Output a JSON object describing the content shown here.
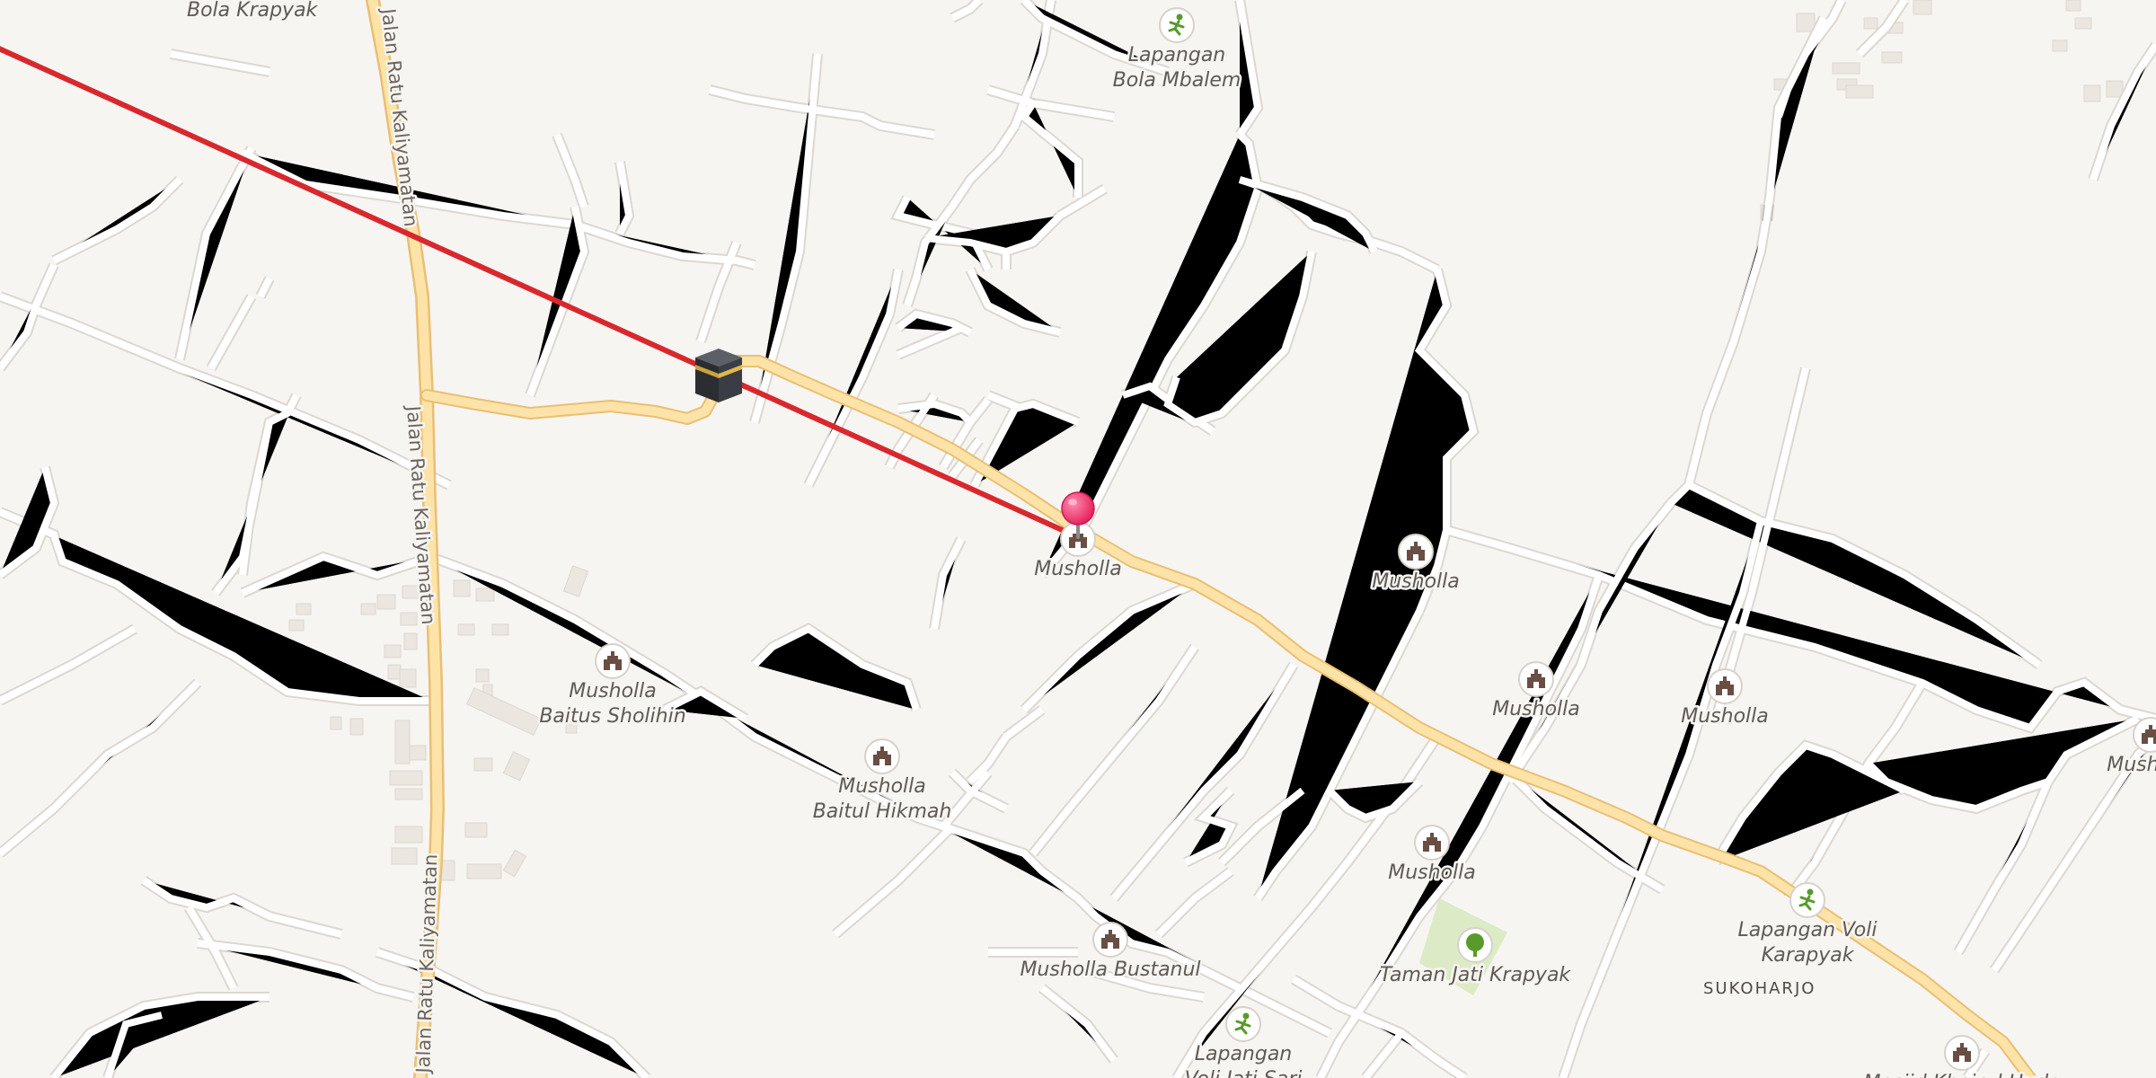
{
  "map": {
    "road_labels": [
      "Jalan Ratu Kaliyamatan",
      "Jalan Ratu Kaliyamatan",
      "Jalan Ratu Kaliyamatan"
    ],
    "area_labels": [
      "SUKOHARJO"
    ],
    "pois": [
      {
        "type": "musholla",
        "icon": "mosque-icon",
        "lines": [
          "Musholla"
        ]
      },
      {
        "type": "musholla",
        "icon": "mosque-icon",
        "lines": [
          "Musholla"
        ]
      },
      {
        "type": "musholla",
        "icon": "mosque-icon",
        "lines": [
          "Musholla"
        ]
      },
      {
        "type": "musholla",
        "icon": "mosque-icon",
        "lines": [
          "Musholla"
        ]
      },
      {
        "type": "musholla",
        "icon": "mosque-icon",
        "lines": [
          "Musholla"
        ]
      },
      {
        "type": "musholla",
        "icon": "mosque-icon",
        "lines": [
          "Musholla"
        ]
      },
      {
        "type": "musholla",
        "icon": "mosque-icon",
        "lines": [
          "Musholla",
          "Baitus Sholihin"
        ]
      },
      {
        "type": "musholla",
        "icon": "mosque-icon",
        "lines": [
          "Musholla",
          "Baitul Hikmah"
        ]
      },
      {
        "type": "musholla",
        "icon": "mosque-icon",
        "lines": [
          "Musholla Bustanul"
        ]
      },
      {
        "type": "musholla",
        "icon": "mosque-icon",
        "lines": [
          "Masjid Khoirul Huda"
        ]
      },
      {
        "type": "sports",
        "icon": "sports-icon",
        "lines": [
          "Lapangan",
          "Bola Mbalem"
        ]
      },
      {
        "type": "sports",
        "icon": "sports-icon",
        "lines": [
          "Lapangan Voli",
          "Karapyak"
        ]
      },
      {
        "type": "sports",
        "icon": "sports-icon",
        "lines": [
          "Lapangan",
          "Voli Jati Sari"
        ]
      },
      {
        "type": "park",
        "icon": "tree-icon",
        "lines": [
          "Taman Jati Krapyak"
        ]
      },
      {
        "type": "place",
        "icon": "",
        "lines": [
          "Bola Krapyak"
        ]
      }
    ],
    "colors": {
      "background": "#f7f5f2",
      "minor_road": "#ffffff",
      "minor_road_casing": "#dcd7d1",
      "main_road": "#fde3a7",
      "main_road_casing": "#e9bf74",
      "qibla_line": "#d8282e",
      "location_pin": "#ec2a62",
      "park": "#dcebc6"
    },
    "markers": {
      "qibla_icon": "kaaba-icon",
      "location_pin_icon": "location-pin-icon"
    }
  }
}
